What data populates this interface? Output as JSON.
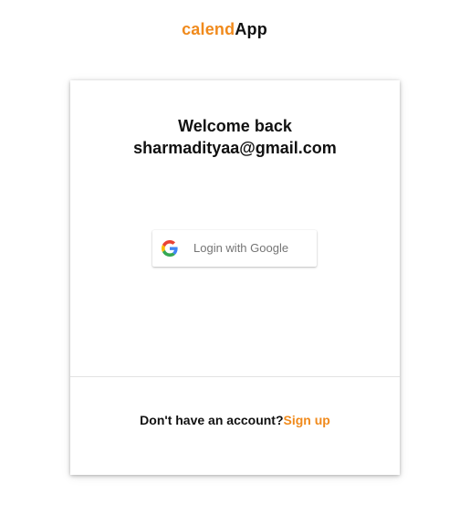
{
  "brand": {
    "accent_text": "calend",
    "main_text": "App",
    "accent_color": "#f08a1c"
  },
  "card": {
    "welcome_line1": "Welcome back",
    "welcome_line2": "sharmadityaa@gmail.com",
    "google_button": {
      "label": "Login with Google",
      "icon": "google-g-icon"
    },
    "footer": {
      "prompt": "Don't have an account?",
      "signup_label": "Sign up"
    }
  }
}
